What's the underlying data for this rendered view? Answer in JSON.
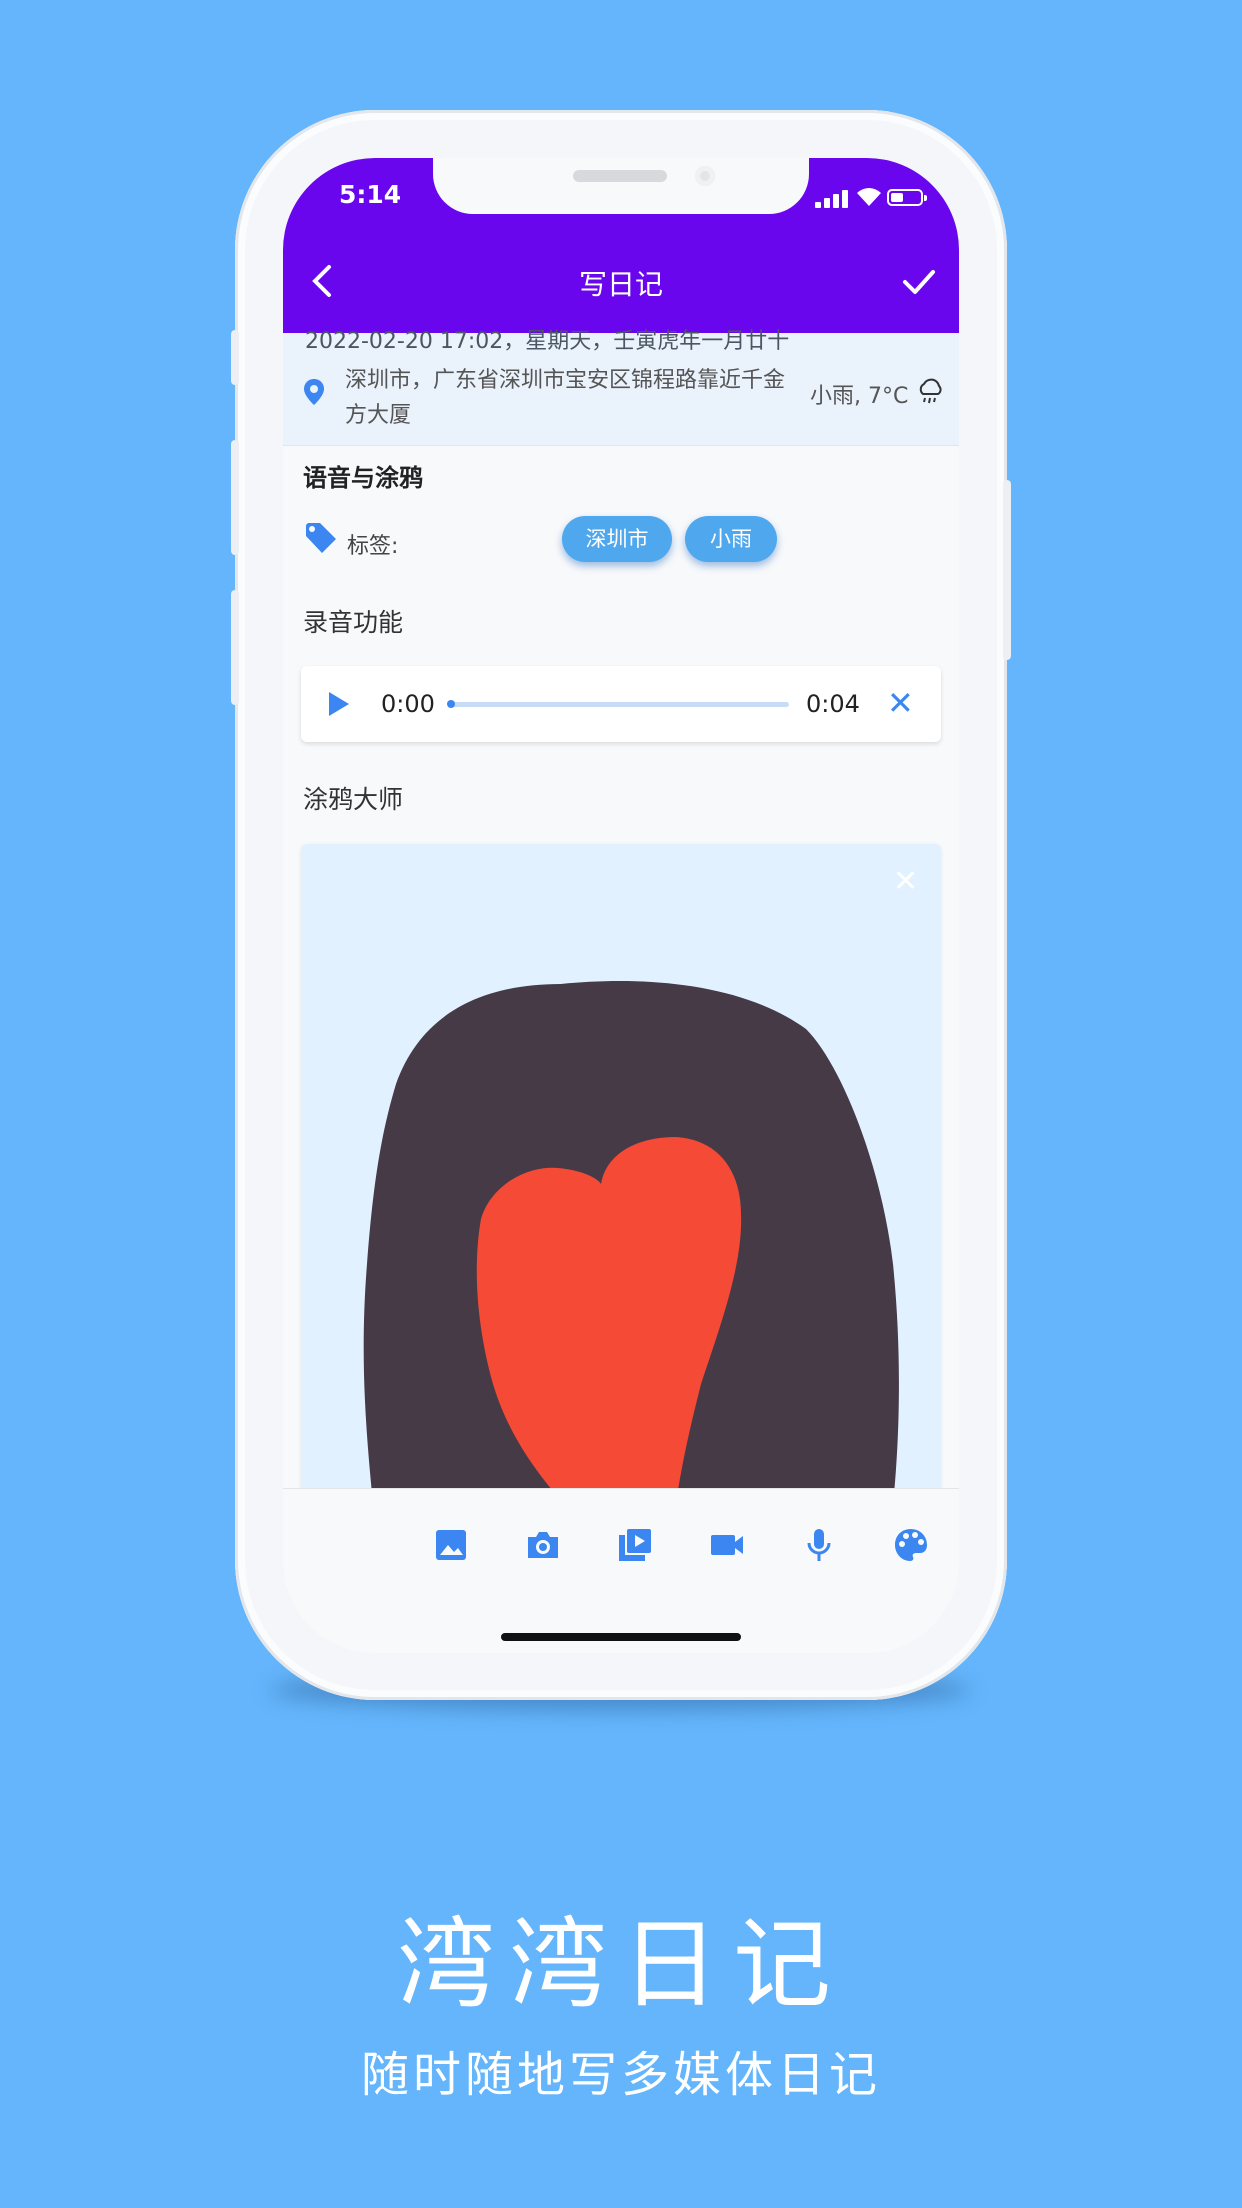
{
  "status_bar": {
    "time": "5:14"
  },
  "app_bar": {
    "title": "写日记"
  },
  "entry_meta": {
    "datetime": "2022-02-20 17:02，星期天，壬寅虎年一月廿十",
    "address": "深圳市，广东省深圳市宝安区锦程路靠近千金方大厦",
    "weather": "小雨, 7°C"
  },
  "entry": {
    "title": "语音与涂鸦",
    "tags_label": "标签:",
    "tags": [
      "深圳市",
      "小雨"
    ],
    "audio_section_label": "录音功能",
    "audio": {
      "current_time": "0:00",
      "duration": "0:04",
      "progress": 0
    },
    "doodle_section_label": "涂鸦大师"
  },
  "toolbar": {
    "items": [
      "image-icon",
      "camera-icon",
      "video-library-icon",
      "videocam-icon",
      "mic-icon",
      "palette-icon"
    ]
  },
  "promo": {
    "app_name": "湾湾日记",
    "tagline": "随时随地写多媒体日记"
  },
  "colors": {
    "background": "#64b5fc",
    "app_bar": "#6a06ee",
    "accent": "#3b86f0",
    "chip": "#4fa8ee",
    "doodle_hair": "#463a47",
    "doodle_heart": "#f44a36"
  }
}
